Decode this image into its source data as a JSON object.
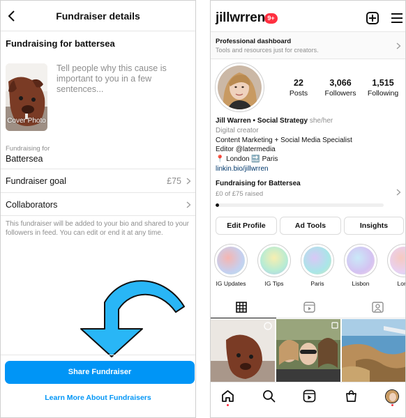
{
  "left": {
    "header_title": "Fundraiser details",
    "subheading": "Fundraising for battersea",
    "cover_photo_label": "Cover Photo",
    "description_placeholder": "Tell people why this cause is important to you in a few sentences...",
    "fundraising_for_label": "Fundraising for",
    "fundraising_for_value": "Battersea",
    "goal_label": "Fundraiser goal",
    "goal_value": "£75",
    "collaborators_label": "Collaborators",
    "note": "This fundraiser will be added to your bio and shared to your followers in feed. You can edit or end it at any time.",
    "share_button": "Share Fundraiser",
    "learn_more": "Learn More About Fundraisers",
    "arrow_color": "#29b6f6"
  },
  "right": {
    "username": "jillwrren",
    "notif_count": "9+",
    "dashboard_title": "Professional dashboard",
    "dashboard_subtitle": "Tools and resources just for creators.",
    "stats": {
      "posts_num": "22",
      "posts_label": "Posts",
      "followers_num": "3,066",
      "followers_label": "Followers",
      "following_num": "1,515",
      "following_label": "Following"
    },
    "bio": {
      "name": "Jill Warren • Social Strategy",
      "pronouns": "she/her",
      "category": "Digital creator",
      "line1": "Content Marketing + Social Media Specialist",
      "line2": "Editor @latermedia",
      "line3": "📍 London 🔜 Paris",
      "link": "linkin.bio/jillwrren"
    },
    "fundraiser": {
      "title": "Fundraising for Battersea",
      "raised": "£0 of £75 raised",
      "progress": 0.02
    },
    "buttons": {
      "edit": "Edit Profile",
      "ad_tools": "Ad Tools",
      "insights": "Insights"
    },
    "highlights": [
      {
        "label": "IG Updates"
      },
      {
        "label": "IG Tips"
      },
      {
        "label": "Paris"
      },
      {
        "label": "Lisbon"
      },
      {
        "label": "Lond"
      }
    ],
    "accent": "#0095f6",
    "badge_color": "#ff3040"
  }
}
